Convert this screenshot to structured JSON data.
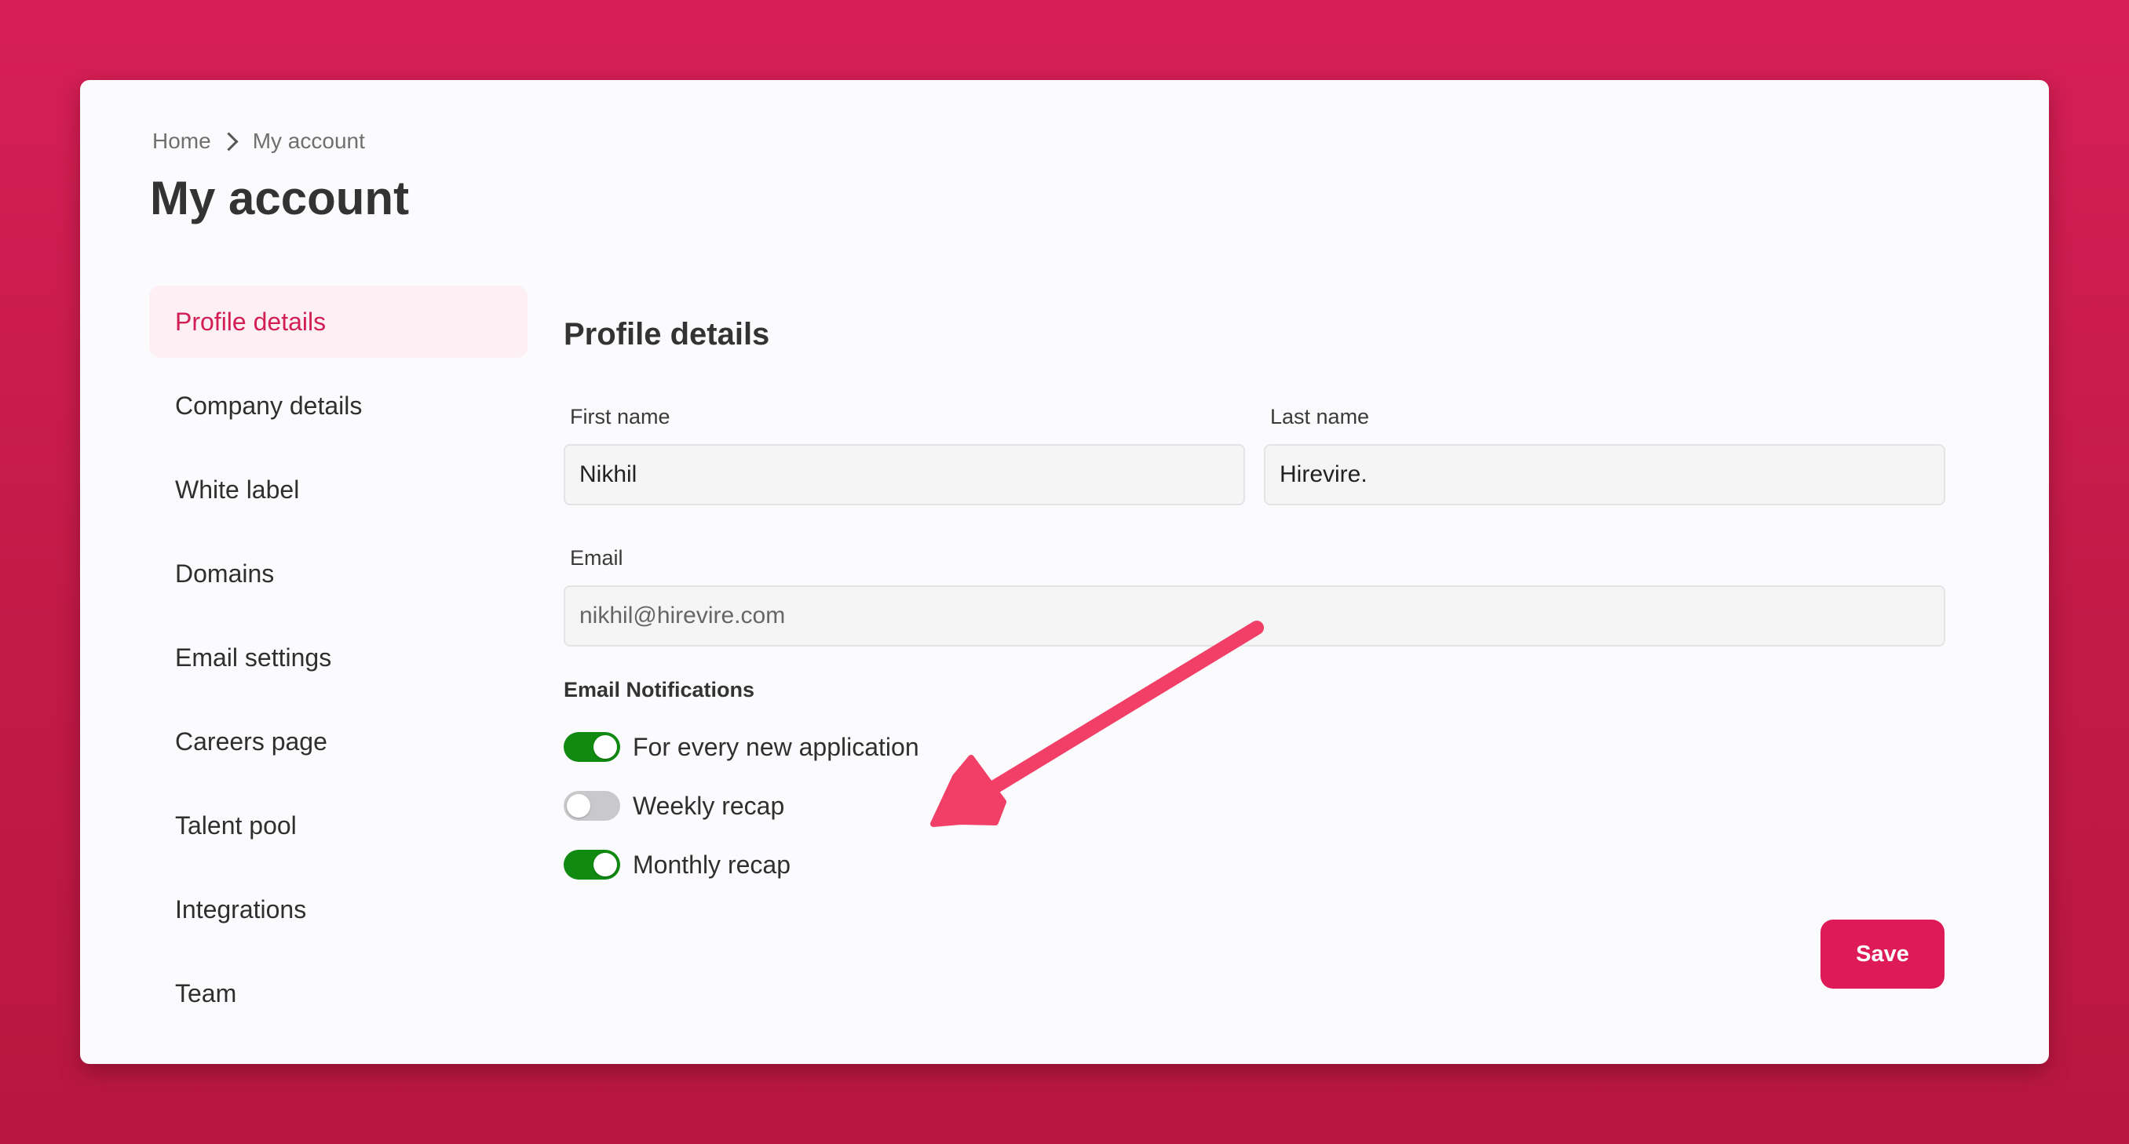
{
  "breadcrumb": {
    "home": "Home",
    "current": "My account"
  },
  "page_title": "My account",
  "sidebar": {
    "items": [
      {
        "label": "Profile details",
        "active": true
      },
      {
        "label": "Company details",
        "active": false
      },
      {
        "label": "White label",
        "active": false
      },
      {
        "label": "Domains",
        "active": false
      },
      {
        "label": "Email settings",
        "active": false
      },
      {
        "label": "Careers page",
        "active": false
      },
      {
        "label": "Talent pool",
        "active": false
      },
      {
        "label": "Integrations",
        "active": false
      },
      {
        "label": "Team",
        "active": false
      }
    ]
  },
  "profile": {
    "section_title": "Profile details",
    "first_name_label": "First name",
    "first_name_value": "Nikhil",
    "last_name_label": "Last name",
    "last_name_value": "Hirevire.",
    "email_label": "Email",
    "email_value": "nikhil@hirevire.com"
  },
  "notifications": {
    "title": "Email Notifications",
    "items": [
      {
        "label": "For every new application",
        "enabled": true
      },
      {
        "label": "Weekly recap",
        "enabled": false
      },
      {
        "label": "Monthly recap",
        "enabled": true
      }
    ]
  },
  "save_label": "Save",
  "icons": {
    "breadcrumb_separator": "chevron-right-icon",
    "annotation": "arrow-annotation-icon"
  },
  "colors": {
    "background": "#d21e55",
    "accent": "#de1b58",
    "toggle_on": "#118a11",
    "toggle_off": "#c9c9cc",
    "annotation_arrow": "#f23f67"
  }
}
